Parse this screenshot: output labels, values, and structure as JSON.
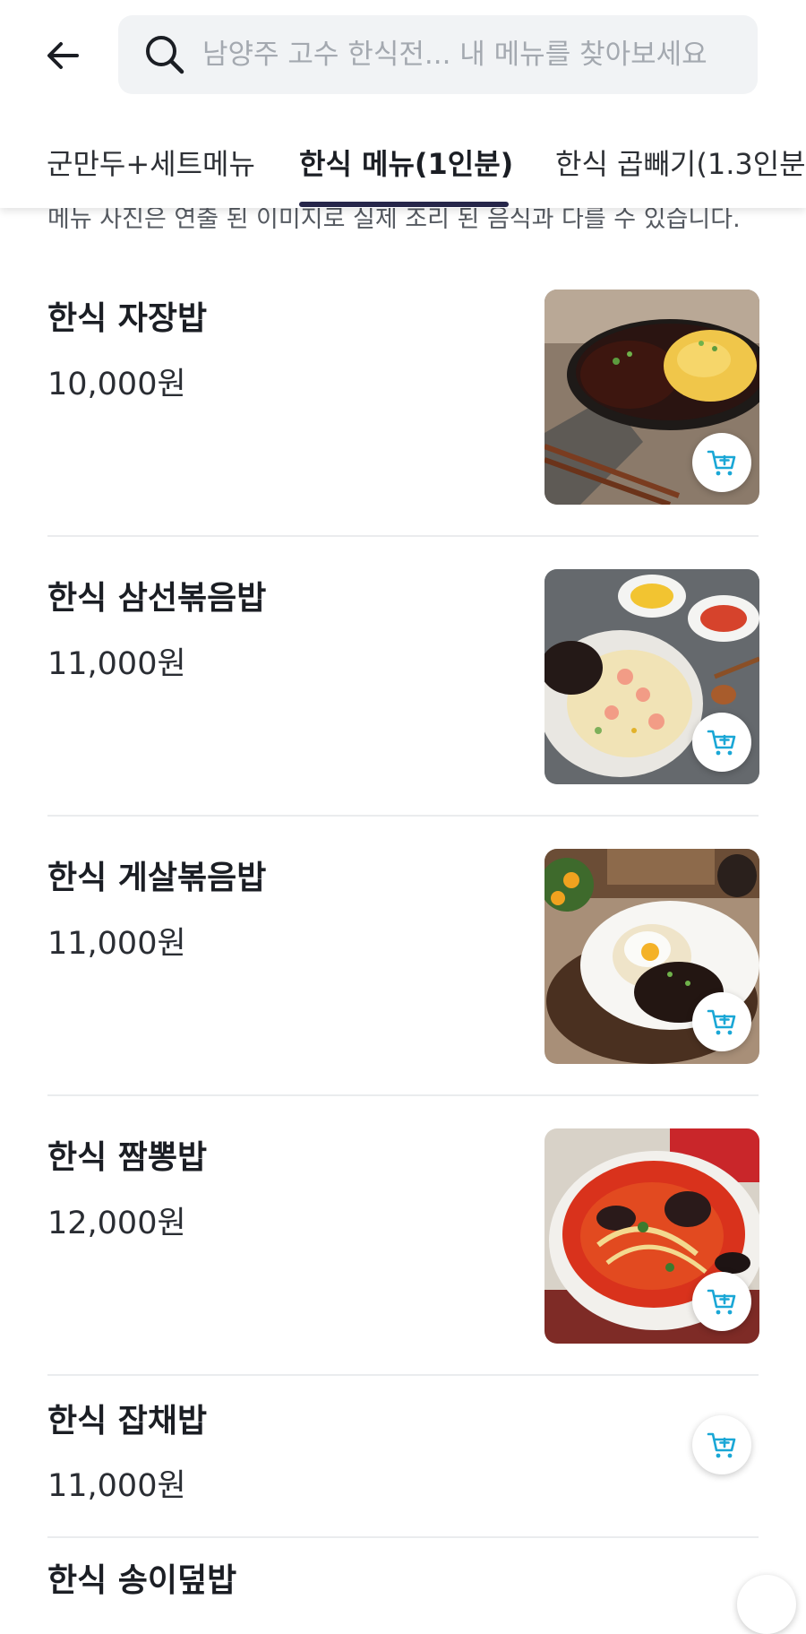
{
  "search": {
    "placeholder": "남양주 고수 한식전... 내 메뉴를 찾아보세요"
  },
  "tabs": [
    {
      "label": "군만두+세트메뉴",
      "active": false
    },
    {
      "label": "한식 메뉴(1인분)",
      "active": true
    },
    {
      "label": "한식 곱빼기(1.3인분",
      "active": false
    }
  ],
  "notice": "메뉴 사진은 연출 된 이미지로 실제 조리 된 음식과 다를 수 있습니다.",
  "menu": [
    {
      "name": "한식 자장밥",
      "price": "10,000원",
      "image": "jajang-rice-with-omelette-photo"
    },
    {
      "name": "한식 삼선볶음밥",
      "price": "11,000원",
      "image": "seafood-fried-rice-photo"
    },
    {
      "name": "한식 게살볶음밥",
      "price": "11,000원",
      "image": "crab-fried-rice-photo"
    },
    {
      "name": "한식 짬뽕밥",
      "price": "12,000원",
      "image": "jjamppong-rice-photo"
    },
    {
      "name": "한식 잡채밥",
      "price": "11,000원"
    },
    {
      "name": "한식 송이덮밥"
    }
  ],
  "colors": {
    "accent": "#1aa7d6",
    "tab_indicator": "#26264a",
    "search_bg": "#f1f3f5",
    "divider": "#eaecee"
  },
  "icons": [
    "back-arrow-icon",
    "search-icon",
    "add-to-cart-icon"
  ]
}
